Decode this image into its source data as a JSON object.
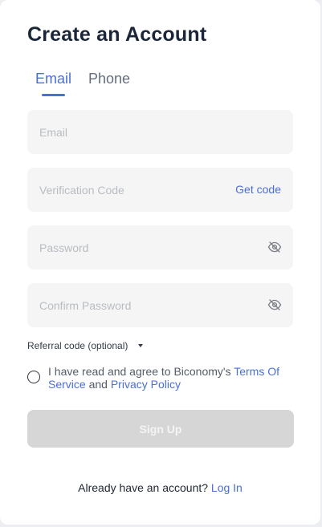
{
  "title": "Create an Account",
  "tabs": [
    {
      "label": "Email",
      "active": true
    },
    {
      "label": "Phone",
      "active": false
    }
  ],
  "fields": {
    "email": {
      "placeholder": "Email",
      "value": ""
    },
    "verification_code": {
      "placeholder": "Verification Code",
      "value": "",
      "action_label": "Get code"
    },
    "password": {
      "placeholder": "Password",
      "value": "",
      "icon": "eye-off-icon"
    },
    "confirm_password": {
      "placeholder": "Confirm Password",
      "value": "",
      "icon": "eye-off-icon"
    }
  },
  "referral": {
    "label": "Referral code (optional)",
    "icon": "caret-down-icon"
  },
  "agreement": {
    "checked": false,
    "prefix": "I have read and agree to Biconomy's ",
    "terms_link": "Terms Of Service",
    "conjunction": " and ",
    "privacy_link": "Privacy Policy"
  },
  "signup_label": "Sign Up",
  "login": {
    "prompt": "Already have an account? ",
    "link": "Log In"
  },
  "colors": {
    "accent": "#4a6fd8",
    "title": "#1c2639",
    "field_bg": "#f5f5f5",
    "button_disabled_bg": "#d6d6d6",
    "card_bg": "#ffffff"
  }
}
